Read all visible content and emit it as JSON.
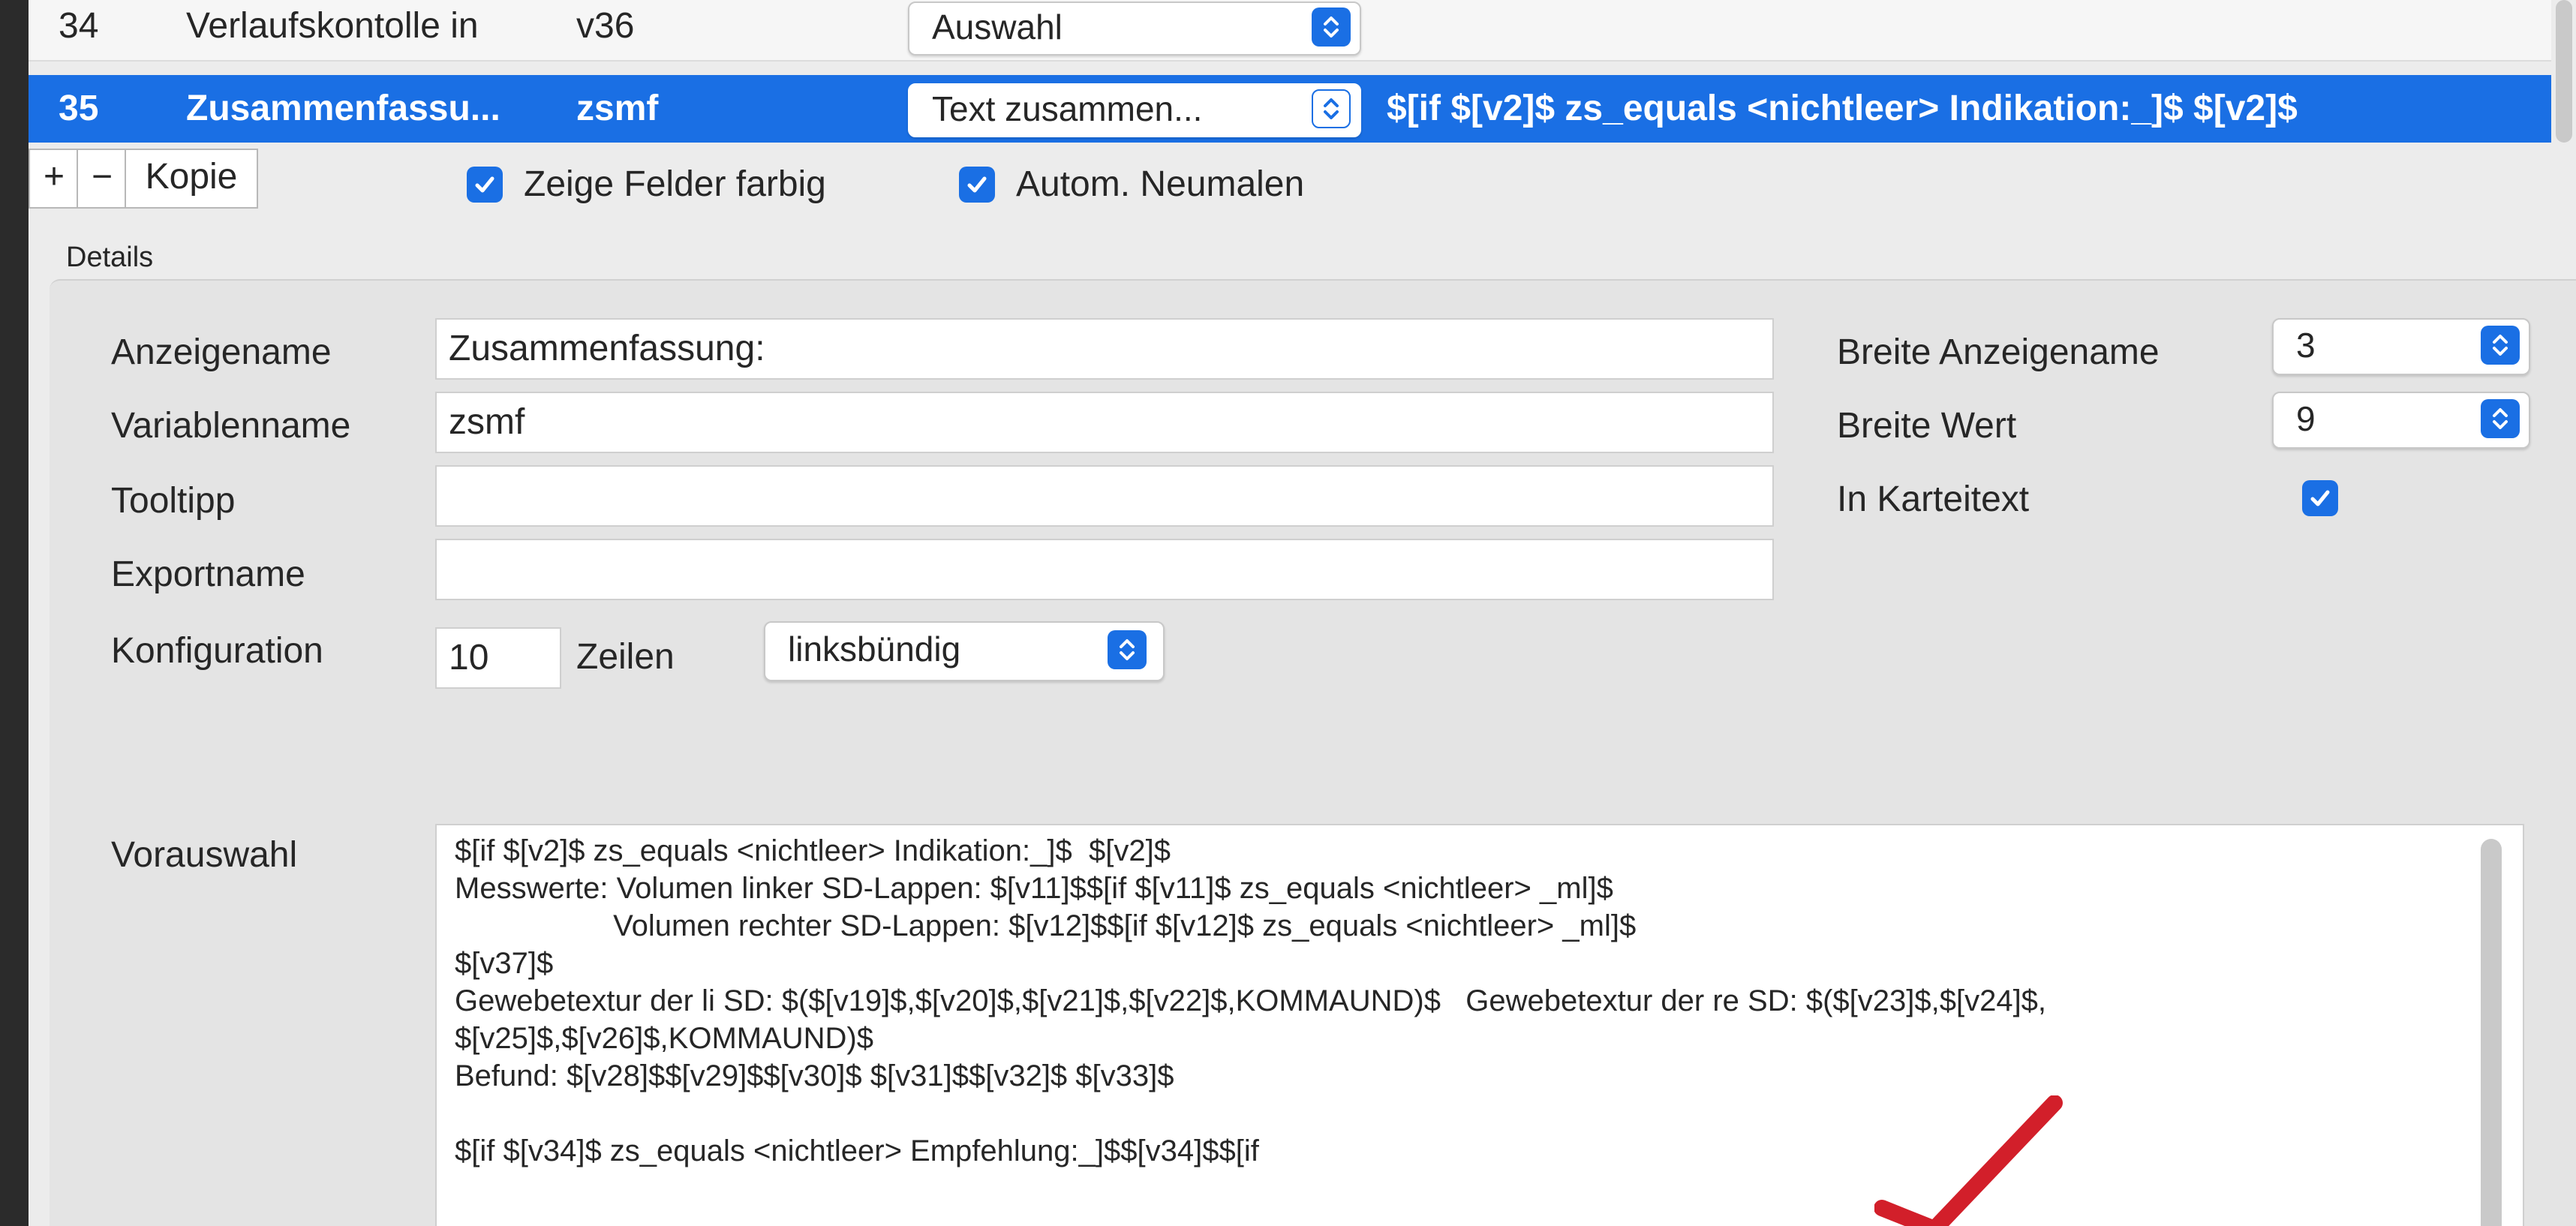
{
  "rows": [
    {
      "num": "34",
      "name": "Verlaufskontolle in",
      "var": "v36",
      "type": "Auswahl",
      "preview": ""
    },
    {
      "num": "35",
      "name": "Zusammenfassu...",
      "var": "zsmf",
      "type": "Text zusammen...",
      "preview": "$[if $[v2]$ zs_equals <nichtleer> Indikation:_]$  $[v2]$"
    }
  ],
  "toolbar": {
    "add_label": "+",
    "remove_label": "−",
    "copy_label": "Kopie",
    "show_colors_label": "Zeige Felder farbig",
    "show_colors_checked": true,
    "auto_redraw_label": "Autom. Neumalen",
    "auto_redraw_checked": true
  },
  "details": {
    "section_label": "Details",
    "anzeigename_label": "Anzeigename",
    "anzeigename_value": "Zusammenfassung:",
    "variablenname_label": "Variablenname",
    "variablenname_value": "zsmf",
    "tooltipp_label": "Tooltipp",
    "tooltipp_value": "",
    "exportname_label": "Exportname",
    "exportname_value": "",
    "konfiguration_label": "Konfiguration",
    "konfiguration_value": "10",
    "zeilen_label": "Zeilen",
    "alignment_value": "linksbündig",
    "breite_anzeigename_label": "Breite Anzeigename",
    "breite_anzeigename_value": "3",
    "breite_wert_label": "Breite Wert",
    "breite_wert_value": "9",
    "in_karteitext_label": "In Karteitext",
    "in_karteitext_checked": true,
    "vorauswahl_label": "Vorauswahl",
    "vorauswahl_lines": [
      "$[if $[v2]$ zs_equals <nichtleer> Indikation:_]$  $[v2]$",
      "Messwerte: Volumen linker SD-Lappen: $[v11]$$[if $[v11]$ zs_equals <nichtleer> _ml]$",
      "                   Volumen rechter SD-Lappen: $[v12]$$[if $[v12]$ zs_equals <nichtleer> _ml]$",
      "$[v37]$",
      "Gewebetextur der li SD: $($[v19]$,$[v20]$,$[v21]$,$[v22]$,KOMMAUND)$   Gewebetextur der re SD: $($[v23]$,$[v24]$,",
      "$[v25]$,$[v26]$,KOMMAUND)$",
      "Befund: $[v28]$$[v29]$$[v30]$ $[v31]$$[v32]$ $[v33]$",
      "",
      "$[if $[v34]$ zs_equals <nichtleer> Empfehlung:_]$$[v34]$$[if"
    ]
  },
  "colors": {
    "selection": "#1a6fe4",
    "annotation_check": "#d21f2a"
  }
}
